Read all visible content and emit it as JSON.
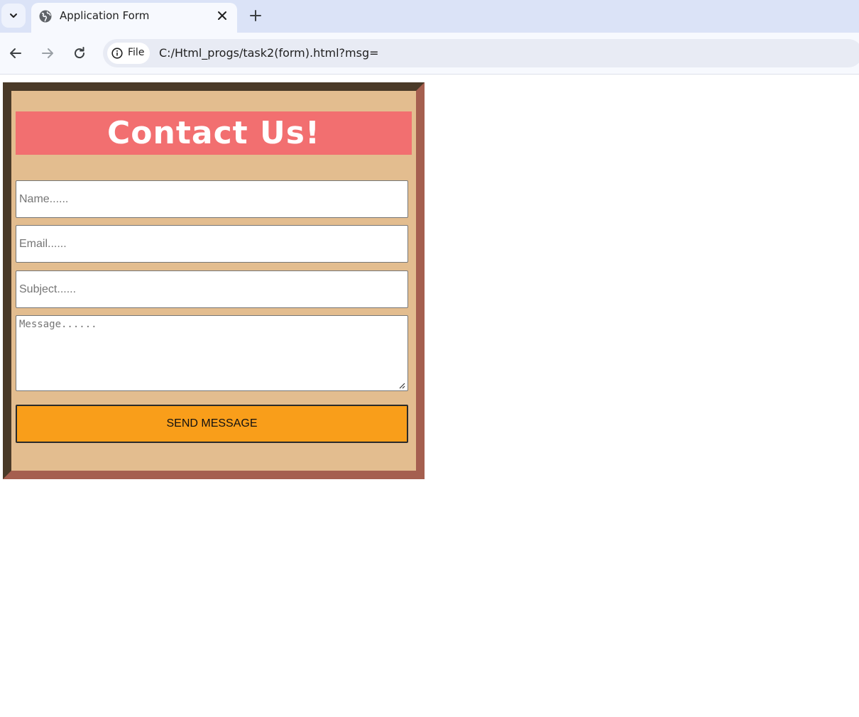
{
  "browser": {
    "tab_title": "Application Form",
    "site_chip_label": "File",
    "url": "C:/Html_progs/task2(form).html?msg=",
    "icons": {
      "tab_list": "chevron-down-icon",
      "favicon": "globe-icon",
      "close_tab": "close-icon",
      "new_tab": "plus-icon",
      "back": "arrow-left-icon",
      "forward": "arrow-right-icon",
      "reload": "reload-icon",
      "site_info": "info-icon"
    }
  },
  "form": {
    "heading": "Contact Us!",
    "name_placeholder": "Name......",
    "email_placeholder": "Email......",
    "subject_placeholder": "Subject......",
    "message_placeholder": "Message......",
    "submit_label": "SEND MESSAGE"
  },
  "colors": {
    "page_background": "#e3bd8f",
    "heading_background": "#f26f70",
    "heading_text": "#ffffff",
    "button_background": "#f99e1a",
    "frame_dark": "#4a3a28",
    "frame_light": "#a55f4f"
  }
}
